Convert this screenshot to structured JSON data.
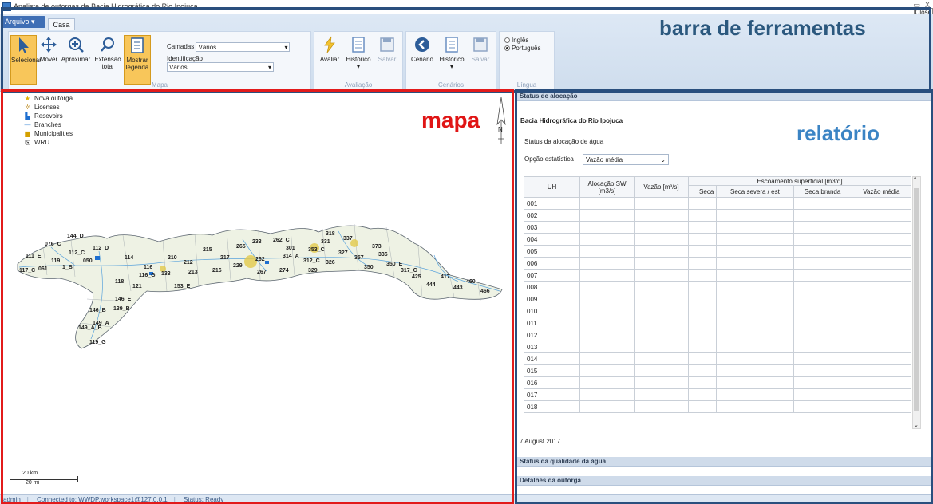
{
  "window": {
    "title": "Analista de outorgas da Bacia Hidrográfica do Rio Ipojuca",
    "close_tip": "Close"
  },
  "ribbon": {
    "file_menu": "Arquivo",
    "tab": "Casa",
    "mapa_group": {
      "label": "Mapa",
      "buttons": [
        "Selecionar",
        "Mover",
        "Aproximar",
        "Extensão total",
        "Mostrar legenda"
      ],
      "layers_label": "Camadas",
      "layers_value": "Vários",
      "ident_label": "Identificação",
      "ident_value": "Vários"
    },
    "avaliacao_group": {
      "label": "Avaliação",
      "buttons": [
        "Avaliar",
        "Histórico",
        "Salvar"
      ]
    },
    "cenarios_group": {
      "label": "Cenários",
      "buttons": [
        "Cenário",
        "Histórico",
        "Salvar"
      ]
    },
    "lingua_group": {
      "label": "Língua",
      "options": [
        "Inglês",
        "Português"
      ],
      "selected": "Português"
    }
  },
  "annotations": {
    "toolbar": "barra de ferramentas",
    "map": "mapa",
    "report": "relatório"
  },
  "map": {
    "legend": [
      {
        "label": "Nova outorga",
        "icon": "star-icon"
      },
      {
        "label": "Licenses",
        "icon": "license-icon"
      },
      {
        "label": "Resevoirs",
        "icon": "reservoir-icon"
      },
      {
        "label": "Branches",
        "icon": "line-icon"
      },
      {
        "label": "Municipalities",
        "icon": "municipality-icon"
      },
      {
        "label": "WRU",
        "icon": "wru-icon"
      }
    ],
    "north": "N",
    "scale_km": "20 km",
    "scale_mi": "20 mi",
    "unit_labels": [
      "076_C",
      "144_D",
      "111_E",
      "112_C",
      "050",
      "119",
      "112_D",
      "114",
      "116",
      "133",
      "061",
      "116_G",
      "117_C",
      "118",
      "121",
      "146_E",
      "153_E",
      "139_B",
      "146_B",
      "149_A",
      "149_A_B",
      "119_G",
      "1_B",
      "212",
      "215",
      "213",
      "216",
      "210",
      "217",
      "265",
      "229",
      "233",
      "262",
      "262_C",
      "267",
      "274",
      "314_A",
      "353_C",
      "312_C",
      "331",
      "326",
      "327",
      "357",
      "337",
      "350",
      "373",
      "318",
      "336",
      "329",
      "350_E",
      "301",
      "317_C",
      "425",
      "444",
      "417",
      "443",
      "460",
      "466"
    ]
  },
  "report": {
    "sections": {
      "allocation": "Status de alocação",
      "quality": "Status da qualidade da água",
      "details": "Detalhes da outorga"
    },
    "basin": "Bacia Hidrográfica do Rio Ipojuca",
    "subtitle": "Status da alocação de água",
    "option_label": "Opção estatística",
    "option_value": "Vazão média",
    "table": {
      "headers": {
        "uh": "UH",
        "alloc": "Alocação SW [m3/s]",
        "flow": "Vazão [m³/s]",
        "runoff": "Escoamento superficial [m3/d]",
        "sub": [
          "Seca",
          "Seca severa / est",
          "Seca branda",
          "Vazão média"
        ]
      },
      "rows": [
        "001",
        "002",
        "003",
        "004",
        "005",
        "006",
        "007",
        "008",
        "009",
        "010",
        "011",
        "012",
        "013",
        "014",
        "015",
        "016",
        "017",
        "018"
      ]
    },
    "date": "7 August 2017"
  },
  "status": {
    "user": "admin",
    "connection": "Connected to: WWDP.workspace1@127.0.0.1",
    "state": "Status: Ready"
  },
  "colors": {
    "toolbar_frame": "#2a4f7e",
    "map_frame": "#e21b1b",
    "report_label": "#3b84c4",
    "active_button": "#f8c65a"
  }
}
